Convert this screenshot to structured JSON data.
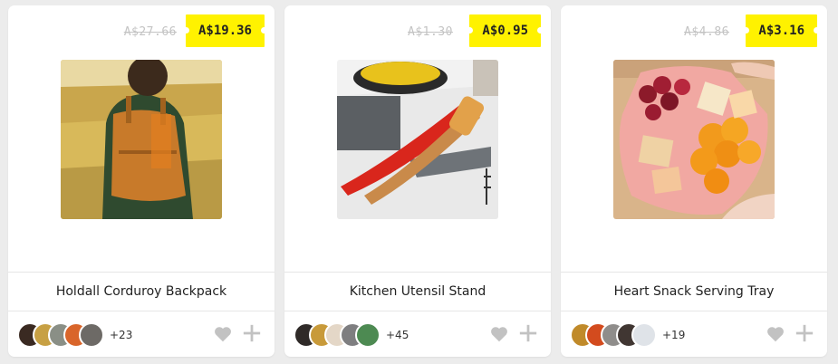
{
  "products": [
    {
      "name": "Holdall Corduroy Backpack",
      "old_price": "A$27.66",
      "price": "A$19.36",
      "supporters_more": "+23",
      "avatar_colors": [
        "#3a2a22",
        "#c7a043",
        "#8a8f86",
        "#d9652a",
        "#6d6a66"
      ]
    },
    {
      "name": "Kitchen Utensil Stand",
      "old_price": "A$1.30",
      "price": "A$0.95",
      "supporters_more": "+45",
      "avatar_colors": [
        "#2f2a28",
        "#c89a3a",
        "#e4d7c7",
        "#7e7e80",
        "#4d8a52"
      ]
    },
    {
      "name": "Heart Snack Serving Tray",
      "old_price": "A$4.86",
      "price": "A$3.16",
      "supporters_more": "+19",
      "avatar_colors": [
        "#c08a2a",
        "#d34b1e",
        "#8f8d8b",
        "#403632",
        "#dfe3e8"
      ]
    }
  ],
  "icons": {
    "like": "heart-icon",
    "add": "plus-icon"
  },
  "colors": {
    "price_tag": "#fff200",
    "background": "#ececec",
    "icon_gray": "#c2c2c2"
  }
}
